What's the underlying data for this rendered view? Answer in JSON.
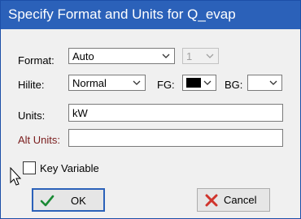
{
  "window": {
    "title": "Specify Format and Units for Q_evap"
  },
  "format": {
    "label": "Format:",
    "value": "Auto",
    "precision": "1"
  },
  "hilite": {
    "label": "Hilite:",
    "value": "Normal"
  },
  "fg": {
    "label": "FG:",
    "color": "#000000"
  },
  "bg": {
    "label": "BG:",
    "color": "#ffffff"
  },
  "units": {
    "label": "Units:",
    "value": "kW"
  },
  "alt_units": {
    "label": "Alt Units:",
    "value": ""
  },
  "key_variable": {
    "label": "Key Variable",
    "checked": false
  },
  "buttons": {
    "ok": "OK",
    "cancel": "Cancel"
  },
  "colors": {
    "titlebar": "#2b61b9",
    "ok_check": "#1a8a35",
    "cancel_x": "#d0342c",
    "alt_units_label": "#7a1d1d"
  }
}
